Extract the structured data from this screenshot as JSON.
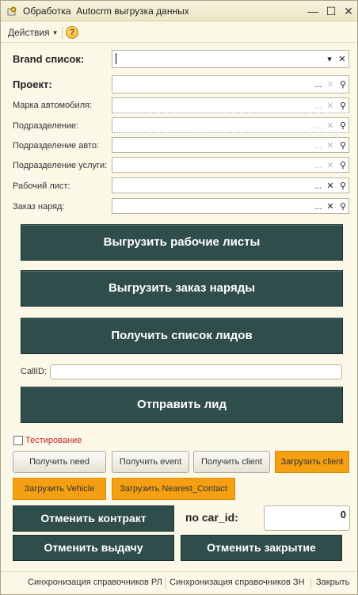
{
  "window": {
    "title": "Обработка  Autocrm выгрузка данных",
    "icon": "processing-icon",
    "controls": [
      "minimize-icon",
      "maximize-icon",
      "close-icon"
    ]
  },
  "toolbar": {
    "actions_label": "Действия",
    "help_label": "?"
  },
  "form": {
    "brand": {
      "label": "Brand список:",
      "value": ""
    },
    "project": {
      "label": "Проект:",
      "value": ""
    },
    "car_brand": {
      "label": "Марка автомобиля:",
      "value": ""
    },
    "division": {
      "label": "Подразделение:",
      "value": ""
    },
    "division_auto": {
      "label": "Подразделение авто:",
      "value": ""
    },
    "division_services": {
      "label": "Подразделение услуги:",
      "value": ""
    },
    "worksheet": {
      "label": "Рабочий лист:",
      "value": ""
    },
    "work_order": {
      "label": "Заказ наряд:",
      "value": ""
    },
    "field_button_glyphs": {
      "select": "...",
      "clear": "✕",
      "open": "⚲",
      "dropdown": "▾"
    }
  },
  "actions": {
    "upload_worksheets": "Выгрузить рабочие листы",
    "upload_work_orders": "Выгрузить заказ наряды",
    "get_leads": "Получить список лидов",
    "callid_label": "CallID:",
    "callid_value": "",
    "send_lead": "Отправить лид"
  },
  "testing": {
    "checkbox_label": "Тестирование",
    "checked": false,
    "buttons": {
      "get_need": "Получить need",
      "get_event": "Получить event",
      "get_client": "Получить client",
      "load_client": "Загрузить client",
      "load_vehicle": "Загрузить Vehicle",
      "load_nearest_contact": "Загрузить Nearest_Contact"
    },
    "orange_color": "#f4a012"
  },
  "bottom": {
    "cancel_contract": "Отменить контракт",
    "car_id_label": "по car_id:",
    "car_id_value": "0",
    "cancel_issue": "Отменить выдачу",
    "cancel_close": "Отменить закрытие"
  },
  "footer": {
    "sync_rl": "Синхронизация справочников РЛ",
    "sync_zn": "Синхронизация справочников ЗН",
    "close": "Закрыть"
  },
  "colors": {
    "window_bg": "#fbf8e8",
    "dark_button": "#2f4d4b",
    "orange_button": "#f4a012",
    "testing_label": "#c0282d"
  }
}
